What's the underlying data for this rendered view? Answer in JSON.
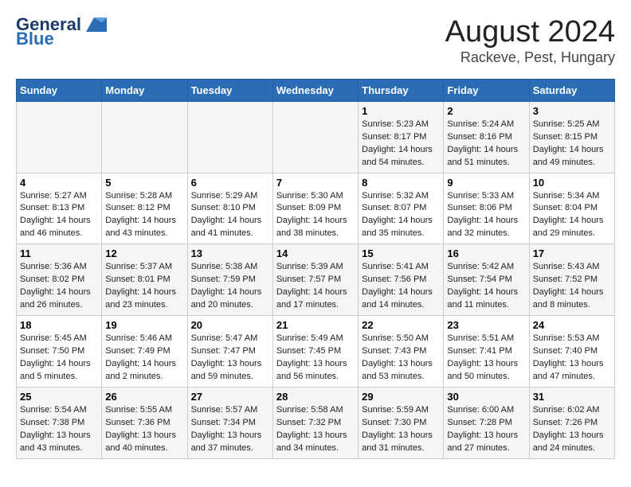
{
  "header": {
    "logo_line1": "General",
    "logo_line2": "Blue",
    "main_title": "August 2024",
    "subtitle": "Rackeve, Pest, Hungary"
  },
  "days_of_week": [
    "Sunday",
    "Monday",
    "Tuesday",
    "Wednesday",
    "Thursday",
    "Friday",
    "Saturday"
  ],
  "weeks": [
    {
      "days": [
        {
          "num": "",
          "info": ""
        },
        {
          "num": "",
          "info": ""
        },
        {
          "num": "",
          "info": ""
        },
        {
          "num": "",
          "info": ""
        },
        {
          "num": "1",
          "info": "Sunrise: 5:23 AM\nSunset: 8:17 PM\nDaylight: 14 hours\nand 54 minutes."
        },
        {
          "num": "2",
          "info": "Sunrise: 5:24 AM\nSunset: 8:16 PM\nDaylight: 14 hours\nand 51 minutes."
        },
        {
          "num": "3",
          "info": "Sunrise: 5:25 AM\nSunset: 8:15 PM\nDaylight: 14 hours\nand 49 minutes."
        }
      ]
    },
    {
      "days": [
        {
          "num": "4",
          "info": "Sunrise: 5:27 AM\nSunset: 8:13 PM\nDaylight: 14 hours\nand 46 minutes."
        },
        {
          "num": "5",
          "info": "Sunrise: 5:28 AM\nSunset: 8:12 PM\nDaylight: 14 hours\nand 43 minutes."
        },
        {
          "num": "6",
          "info": "Sunrise: 5:29 AM\nSunset: 8:10 PM\nDaylight: 14 hours\nand 41 minutes."
        },
        {
          "num": "7",
          "info": "Sunrise: 5:30 AM\nSunset: 8:09 PM\nDaylight: 14 hours\nand 38 minutes."
        },
        {
          "num": "8",
          "info": "Sunrise: 5:32 AM\nSunset: 8:07 PM\nDaylight: 14 hours\nand 35 minutes."
        },
        {
          "num": "9",
          "info": "Sunrise: 5:33 AM\nSunset: 8:06 PM\nDaylight: 14 hours\nand 32 minutes."
        },
        {
          "num": "10",
          "info": "Sunrise: 5:34 AM\nSunset: 8:04 PM\nDaylight: 14 hours\nand 29 minutes."
        }
      ]
    },
    {
      "days": [
        {
          "num": "11",
          "info": "Sunrise: 5:36 AM\nSunset: 8:02 PM\nDaylight: 14 hours\nand 26 minutes."
        },
        {
          "num": "12",
          "info": "Sunrise: 5:37 AM\nSunset: 8:01 PM\nDaylight: 14 hours\nand 23 minutes."
        },
        {
          "num": "13",
          "info": "Sunrise: 5:38 AM\nSunset: 7:59 PM\nDaylight: 14 hours\nand 20 minutes."
        },
        {
          "num": "14",
          "info": "Sunrise: 5:39 AM\nSunset: 7:57 PM\nDaylight: 14 hours\nand 17 minutes."
        },
        {
          "num": "15",
          "info": "Sunrise: 5:41 AM\nSunset: 7:56 PM\nDaylight: 14 hours\nand 14 minutes."
        },
        {
          "num": "16",
          "info": "Sunrise: 5:42 AM\nSunset: 7:54 PM\nDaylight: 14 hours\nand 11 minutes."
        },
        {
          "num": "17",
          "info": "Sunrise: 5:43 AM\nSunset: 7:52 PM\nDaylight: 14 hours\nand 8 minutes."
        }
      ]
    },
    {
      "days": [
        {
          "num": "18",
          "info": "Sunrise: 5:45 AM\nSunset: 7:50 PM\nDaylight: 14 hours\nand 5 minutes."
        },
        {
          "num": "19",
          "info": "Sunrise: 5:46 AM\nSunset: 7:49 PM\nDaylight: 14 hours\nand 2 minutes."
        },
        {
          "num": "20",
          "info": "Sunrise: 5:47 AM\nSunset: 7:47 PM\nDaylight: 13 hours\nand 59 minutes."
        },
        {
          "num": "21",
          "info": "Sunrise: 5:49 AM\nSunset: 7:45 PM\nDaylight: 13 hours\nand 56 minutes."
        },
        {
          "num": "22",
          "info": "Sunrise: 5:50 AM\nSunset: 7:43 PM\nDaylight: 13 hours\nand 53 minutes."
        },
        {
          "num": "23",
          "info": "Sunrise: 5:51 AM\nSunset: 7:41 PM\nDaylight: 13 hours\nand 50 minutes."
        },
        {
          "num": "24",
          "info": "Sunrise: 5:53 AM\nSunset: 7:40 PM\nDaylight: 13 hours\nand 47 minutes."
        }
      ]
    },
    {
      "days": [
        {
          "num": "25",
          "info": "Sunrise: 5:54 AM\nSunset: 7:38 PM\nDaylight: 13 hours\nand 43 minutes."
        },
        {
          "num": "26",
          "info": "Sunrise: 5:55 AM\nSunset: 7:36 PM\nDaylight: 13 hours\nand 40 minutes."
        },
        {
          "num": "27",
          "info": "Sunrise: 5:57 AM\nSunset: 7:34 PM\nDaylight: 13 hours\nand 37 minutes."
        },
        {
          "num": "28",
          "info": "Sunrise: 5:58 AM\nSunset: 7:32 PM\nDaylight: 13 hours\nand 34 minutes."
        },
        {
          "num": "29",
          "info": "Sunrise: 5:59 AM\nSunset: 7:30 PM\nDaylight: 13 hours\nand 31 minutes."
        },
        {
          "num": "30",
          "info": "Sunrise: 6:00 AM\nSunset: 7:28 PM\nDaylight: 13 hours\nand 27 minutes."
        },
        {
          "num": "31",
          "info": "Sunrise: 6:02 AM\nSunset: 7:26 PM\nDaylight: 13 hours\nand 24 minutes."
        }
      ]
    }
  ]
}
